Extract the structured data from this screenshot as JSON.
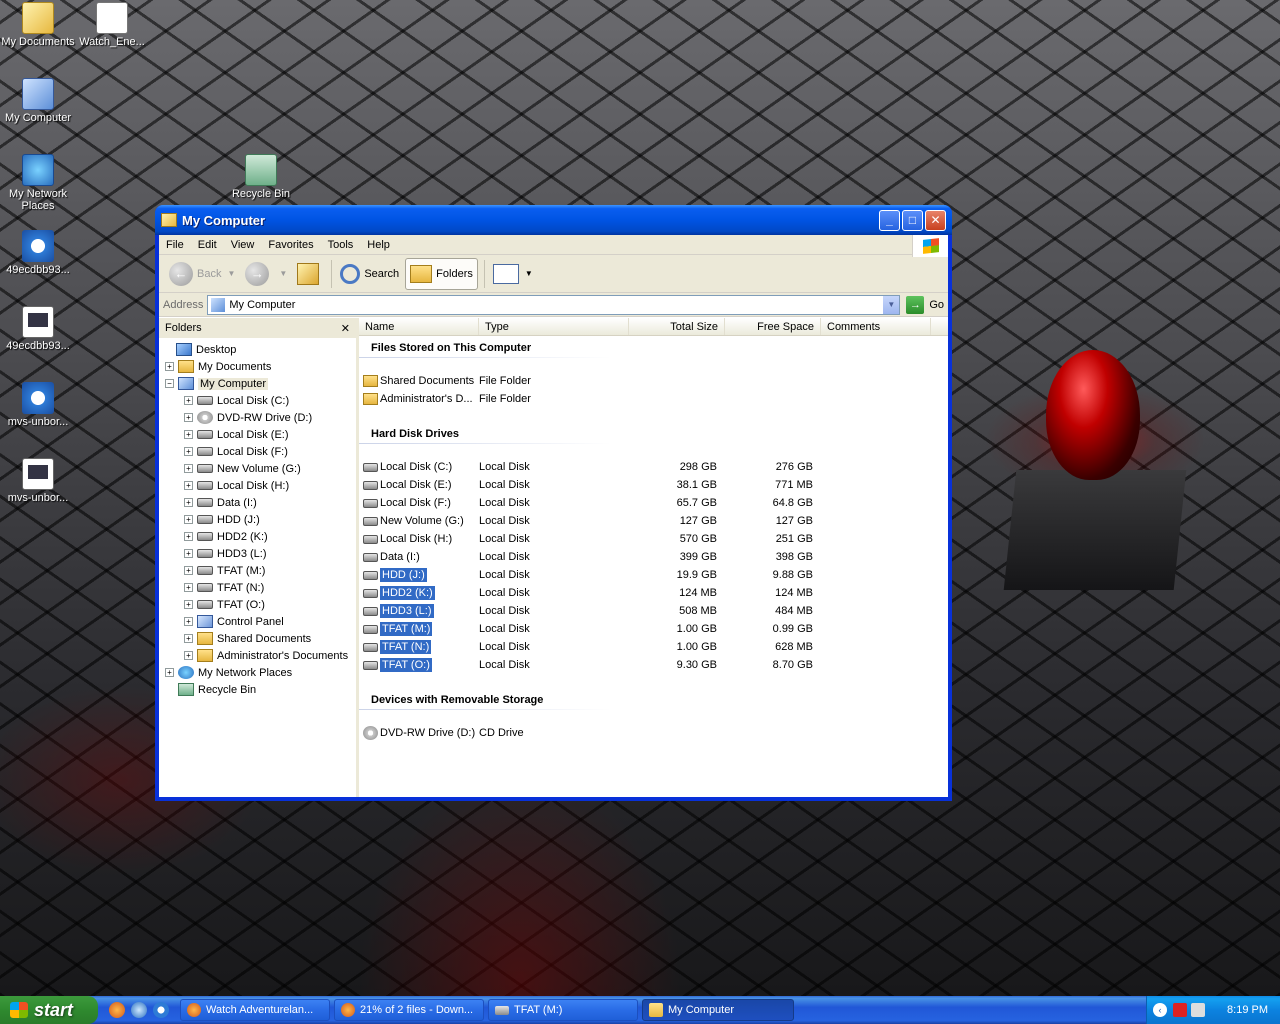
{
  "desktop": {
    "icons": [
      {
        "label": "My Documents",
        "icon": "my-documents-icon"
      },
      {
        "label": "Watch_Ene...",
        "icon": "file-icon"
      },
      {
        "label": "My Computer",
        "icon": "my-computer-icon"
      },
      {
        "label": "My Network Places",
        "icon": "network-places-icon"
      },
      {
        "label": "Recycle Bin",
        "icon": "recycle-bin-icon"
      },
      {
        "label": "49ecdbb93...",
        "icon": "media-file-icon"
      },
      {
        "label": "49ecdbb93...",
        "icon": "video-file-icon"
      },
      {
        "label": "mvs-unbor...",
        "icon": "media-file-icon"
      },
      {
        "label": "mvs-unbor...",
        "icon": "video-file-icon"
      }
    ]
  },
  "window": {
    "title": "My Computer",
    "menu": [
      "File",
      "Edit",
      "View",
      "Favorites",
      "Tools",
      "Help"
    ],
    "toolbar": {
      "back": "Back",
      "search": "Search",
      "folders": "Folders"
    },
    "address": {
      "label": "Address",
      "value": "My Computer",
      "go": "Go"
    },
    "folders_pane": {
      "title": "Folders",
      "close": "✕",
      "tree": {
        "desktop": "Desktop",
        "my_documents": "My Documents",
        "my_computer": "My Computer",
        "children": [
          {
            "label": "Local Disk (C:)",
            "icon": "drive"
          },
          {
            "label": "DVD-RW Drive (D:)",
            "icon": "cd"
          },
          {
            "label": "Local Disk (E:)",
            "icon": "drive"
          },
          {
            "label": "Local Disk (F:)",
            "icon": "drive"
          },
          {
            "label": "New Volume (G:)",
            "icon": "drive"
          },
          {
            "label": "Local Disk (H:)",
            "icon": "drive"
          },
          {
            "label": "Data (I:)",
            "icon": "drive"
          },
          {
            "label": "HDD (J:)",
            "icon": "drive"
          },
          {
            "label": "HDD2 (K:)",
            "icon": "drive"
          },
          {
            "label": "HDD3 (L:)",
            "icon": "drive"
          },
          {
            "label": "TFAT (M:)",
            "icon": "drive"
          },
          {
            "label": "TFAT (N:)",
            "icon": "drive"
          },
          {
            "label": "TFAT (O:)",
            "icon": "drive"
          },
          {
            "label": "Control Panel",
            "icon": "cpl"
          },
          {
            "label": "Shared Documents",
            "icon": "folder"
          },
          {
            "label": "Administrator's Documents",
            "icon": "folder"
          }
        ],
        "network": "My Network Places",
        "recycle": "Recycle Bin"
      }
    },
    "list": {
      "columns": {
        "name": "Name",
        "type": "Type",
        "total": "Total Size",
        "free": "Free Space",
        "comments": "Comments"
      },
      "groups": [
        {
          "title": "Files Stored on This Computer",
          "items": [
            {
              "name": "Shared Documents",
              "type": "File Folder",
              "total": "",
              "free": "",
              "icon": "folder",
              "selected": false
            },
            {
              "name": "Administrator's D...",
              "type": "File Folder",
              "total": "",
              "free": "",
              "icon": "folder",
              "selected": false
            }
          ]
        },
        {
          "title": "Hard Disk Drives",
          "items": [
            {
              "name": "Local Disk (C:)",
              "type": "Local Disk",
              "total": "298 GB",
              "free": "276 GB",
              "icon": "drive",
              "selected": false
            },
            {
              "name": "Local Disk (E:)",
              "type": "Local Disk",
              "total": "38.1 GB",
              "free": "771 MB",
              "icon": "drive",
              "selected": false
            },
            {
              "name": "Local Disk (F:)",
              "type": "Local Disk",
              "total": "65.7 GB",
              "free": "64.8 GB",
              "icon": "drive",
              "selected": false
            },
            {
              "name": "New Volume (G:)",
              "type": "Local Disk",
              "total": "127 GB",
              "free": "127 GB",
              "icon": "drive",
              "selected": false
            },
            {
              "name": "Local Disk (H:)",
              "type": "Local Disk",
              "total": "570 GB",
              "free": "251 GB",
              "icon": "drive",
              "selected": false
            },
            {
              "name": "Data (I:)",
              "type": "Local Disk",
              "total": "399 GB",
              "free": "398 GB",
              "icon": "drive",
              "selected": false
            },
            {
              "name": "HDD (J:)",
              "type": "Local Disk",
              "total": "19.9 GB",
              "free": "9.88 GB",
              "icon": "drive",
              "selected": true
            },
            {
              "name": "HDD2 (K:)",
              "type": "Local Disk",
              "total": "124 MB",
              "free": "124 MB",
              "icon": "drive",
              "selected": true
            },
            {
              "name": "HDD3 (L:)",
              "type": "Local Disk",
              "total": "508 MB",
              "free": "484 MB",
              "icon": "drive",
              "selected": true
            },
            {
              "name": "TFAT (M:)",
              "type": "Local Disk",
              "total": "1.00 GB",
              "free": "0.99 GB",
              "icon": "drive",
              "selected": true
            },
            {
              "name": "TFAT (N:)",
              "type": "Local Disk",
              "total": "1.00 GB",
              "free": "628 MB",
              "icon": "drive",
              "selected": true
            },
            {
              "name": "TFAT (O:)",
              "type": "Local Disk",
              "total": "9.30 GB",
              "free": "8.70 GB",
              "icon": "drive",
              "selected": true
            }
          ]
        },
        {
          "title": "Devices with Removable Storage",
          "items": [
            {
              "name": "DVD-RW Drive (D:)",
              "type": "CD Drive",
              "total": "",
              "free": "",
              "icon": "cd",
              "selected": false
            }
          ]
        }
      ]
    }
  },
  "taskbar": {
    "start": "start",
    "tasks": [
      {
        "label": "Watch Adventurelan...",
        "icon": "ff",
        "active": false
      },
      {
        "label": "21% of 2 files - Down...",
        "icon": "ff",
        "active": false
      },
      {
        "label": "TFAT (M:)",
        "icon": "drive",
        "active": false
      },
      {
        "label": "My Computer",
        "icon": "folder",
        "active": true
      }
    ],
    "clock": "8:19 PM"
  },
  "colors": {
    "title_blue": "#0054e3",
    "selection": "#316ac5",
    "start_green": "#3c9a3c"
  }
}
